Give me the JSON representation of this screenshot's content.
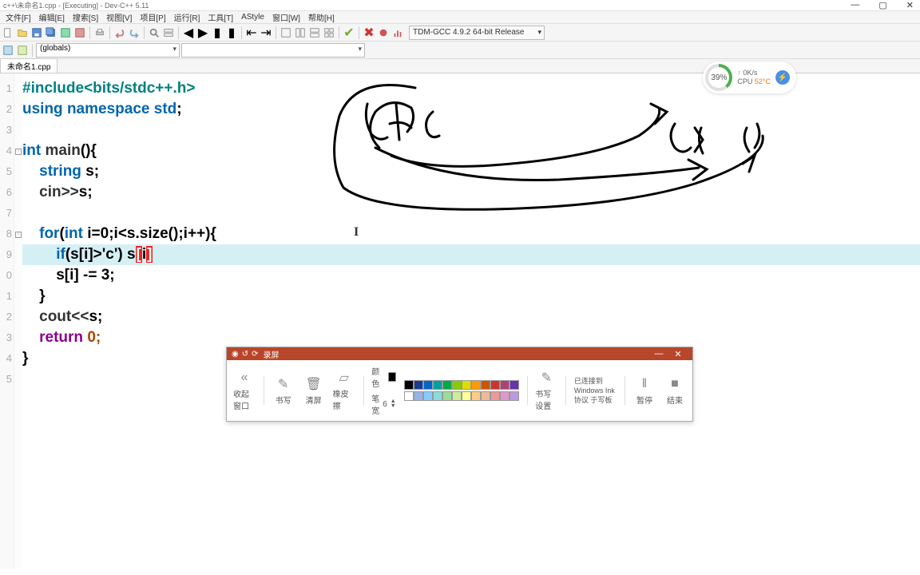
{
  "title": "c++\\未命名1.cpp - [Executing] - Dev-C++ 5.11",
  "menus": [
    "文件[F]",
    "编辑[E]",
    "搜索[S]",
    "视图[V]",
    "项目[P]",
    "运行[R]",
    "工具[T]",
    "AStyle",
    "窗口[W]",
    "帮助[H]"
  ],
  "compiler": "TDM-GCC 4.9.2 64-bit Release",
  "scope_combo": "(globals)",
  "tab": "未命名1.cpp",
  "gutter": [
    "1",
    "2",
    "3",
    "4",
    "5",
    "6",
    "7",
    "8",
    "9",
    "0",
    "1",
    "2",
    "3",
    "4",
    "5"
  ],
  "code": {
    "l1_pp": "#include<bits/stdc++.h>",
    "l2_using": "using",
    "l2_ns": "namespace",
    "l2_std": "std",
    "l2_semi": ";",
    "l4_int": "int",
    "l4_main": "main",
    "l4_p": "(){",
    "l5_str": "string",
    "l5_s": "s;",
    "l6_cin": "cin",
    "l6_op": ">>",
    "l6_s": "s;",
    "l8_for": "for",
    "l8_p1": "(",
    "l8_int": "int",
    "l8_init": "i=0;i<s.size();i++){",
    "l9_if": "if",
    "l9_cond": "(s[i]>'c') s",
    "l9_b1": "[",
    "l9_i": "i",
    "l9_b2": "]",
    "l10": "s[i] -= 3;",
    "l11": "}",
    "l12_cout": "cout",
    "l12_op": "<<",
    "l12_s": "s;",
    "l13_ret": "return",
    "l13_v": "0;",
    "l14": "}"
  },
  "sysmon": {
    "pct": "39%",
    "net": "0K/s",
    "cpu_label": "CPU",
    "cpu_temp": "52°C"
  },
  "annot": {
    "title": "录屏",
    "back": "收起窗口",
    "write": "书写",
    "clear": "清屏",
    "erase": "橡皮擦",
    "color_label": "颜色",
    "width_label": "笔宽",
    "width_val": "6",
    "settings": "书写设置",
    "ink_label": "已连接到 Windows Ink",
    "ink_sub": "协议 于写板",
    "pause": "暂停",
    "end": "结束"
  },
  "palette_row1": [
    "#000000",
    "#1a3b8e",
    "#0066cc",
    "#00a0a0",
    "#00aa44",
    "#88cc00",
    "#dddd00",
    "#ff9900",
    "#cc5500",
    "#cc3333",
    "#aa4477",
    "#6633aa"
  ],
  "palette_row2": [
    "#ffffff",
    "#99b3e6",
    "#88ccff",
    "#88dddd",
    "#99dd99",
    "#ccee99",
    "#ffff99",
    "#ffcc88",
    "#eebb99",
    "#ee9999",
    "#dd99cc",
    "#bb99dd"
  ]
}
